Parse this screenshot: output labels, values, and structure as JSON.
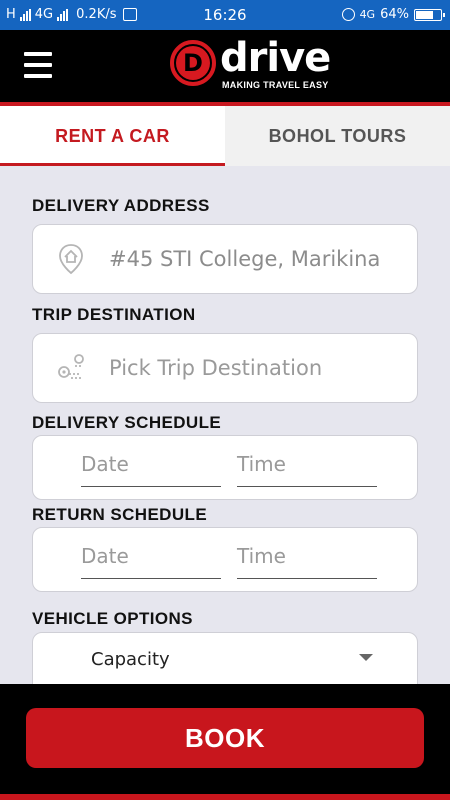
{
  "status_bar": {
    "network_h": "H",
    "network_4g": "4G",
    "speed": "0.2K/s",
    "time": "16:26",
    "network_right": "4G",
    "battery": "64%"
  },
  "header": {
    "logo_letter": "D",
    "logo_word": "drive",
    "logo_tagline": "MAKING TRAVEL EASY",
    "accent_color": "#c8161d"
  },
  "tabs": [
    {
      "label": "RENT A CAR",
      "active": true
    },
    {
      "label": "BOHOL TOURS",
      "active": false
    }
  ],
  "form": {
    "delivery_address": {
      "label": "DELIVERY ADDRESS",
      "value": "#45 STI College, Marikina",
      "icon": "home-location-icon"
    },
    "trip_destination": {
      "label": "TRIP DESTINATION",
      "placeholder": "Pick Trip Destination",
      "icon": "route-pin-icon"
    },
    "delivery_schedule": {
      "label": "DELIVERY SCHEDULE",
      "date_placeholder": "Date",
      "time_placeholder": "Time"
    },
    "return_schedule": {
      "label": "RETURN SCHEDULE",
      "date_placeholder": "Date",
      "time_placeholder": "Time"
    },
    "vehicle_options": {
      "label": "VEHICLE OPTIONS",
      "selected": "Capacity"
    }
  },
  "book_button": {
    "label": "BOOK"
  }
}
